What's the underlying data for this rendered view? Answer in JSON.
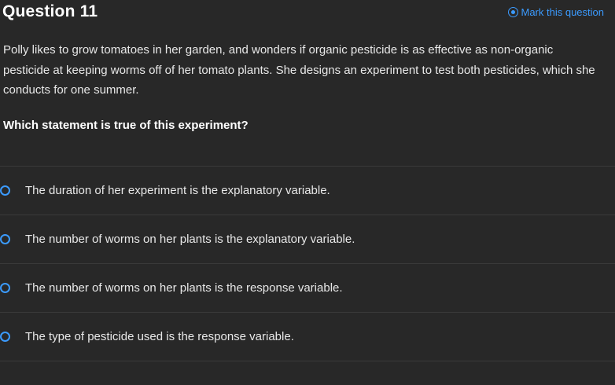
{
  "header": {
    "title": "Question 11",
    "mark_label": "Mark this question"
  },
  "question": {
    "body": "Polly likes to grow tomatoes in her garden, and wonders if organic pesticide is as effective as non-organic pesticide at keeping worms off of her tomato plants. She designs an experiment to test both pesticides, which she conducts for one summer.",
    "prompt": "Which statement is true of this experiment?"
  },
  "choices": [
    {
      "label": "The duration of her experiment is the explanatory variable."
    },
    {
      "label": "The number of worms on her plants is the explanatory variable."
    },
    {
      "label": "The number of worms on her plants is the response variable."
    },
    {
      "label": "The type of pesticide used is the response variable."
    }
  ],
  "colors": {
    "background": "#282828",
    "accent": "#3b9bff",
    "divider": "#3a3a3a"
  }
}
